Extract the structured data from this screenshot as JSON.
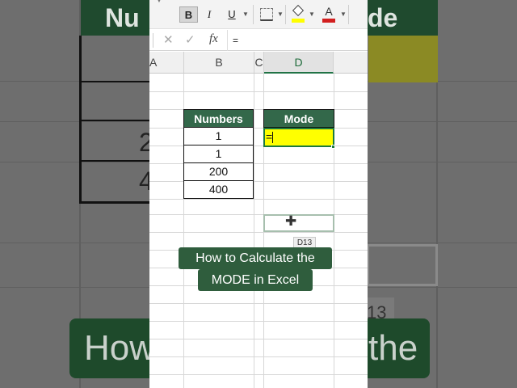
{
  "toolbar": {
    "bold_label": "B",
    "italic_label": "I",
    "underline_label": "U",
    "icons": [
      "borders-icon",
      "fill-color-icon",
      "font-color-icon"
    ],
    "fill_color": "#ffff00",
    "font_color": "#d21f1f"
  },
  "formula_bar": {
    "cancel_symbol": "✕",
    "enter_symbol": "✓",
    "fx_label": "fx",
    "content": "="
  },
  "columns": [
    "A",
    "B",
    "C",
    "D"
  ],
  "selected_column": "D",
  "table": {
    "numbers_header": "Numbers",
    "numbers": [
      "1",
      "1",
      "200",
      "400"
    ],
    "mode_header": "Mode",
    "mode_cell_value": "="
  },
  "cell_tooltip": "D13",
  "caption": {
    "line1": "How to Calculate the",
    "line2": "MODE in Excel"
  },
  "background": {
    "header_left": "Nu",
    "header_right": "de",
    "digits": [
      "2",
      "4"
    ],
    "tag": "13",
    "pill_left": "How",
    "pill_right": "the"
  },
  "colors": {
    "header_green": "#33684a",
    "selection_green": "#1d7a3e",
    "active_fill": "#ffff00",
    "caption_bg": "#2f5d3d"
  }
}
